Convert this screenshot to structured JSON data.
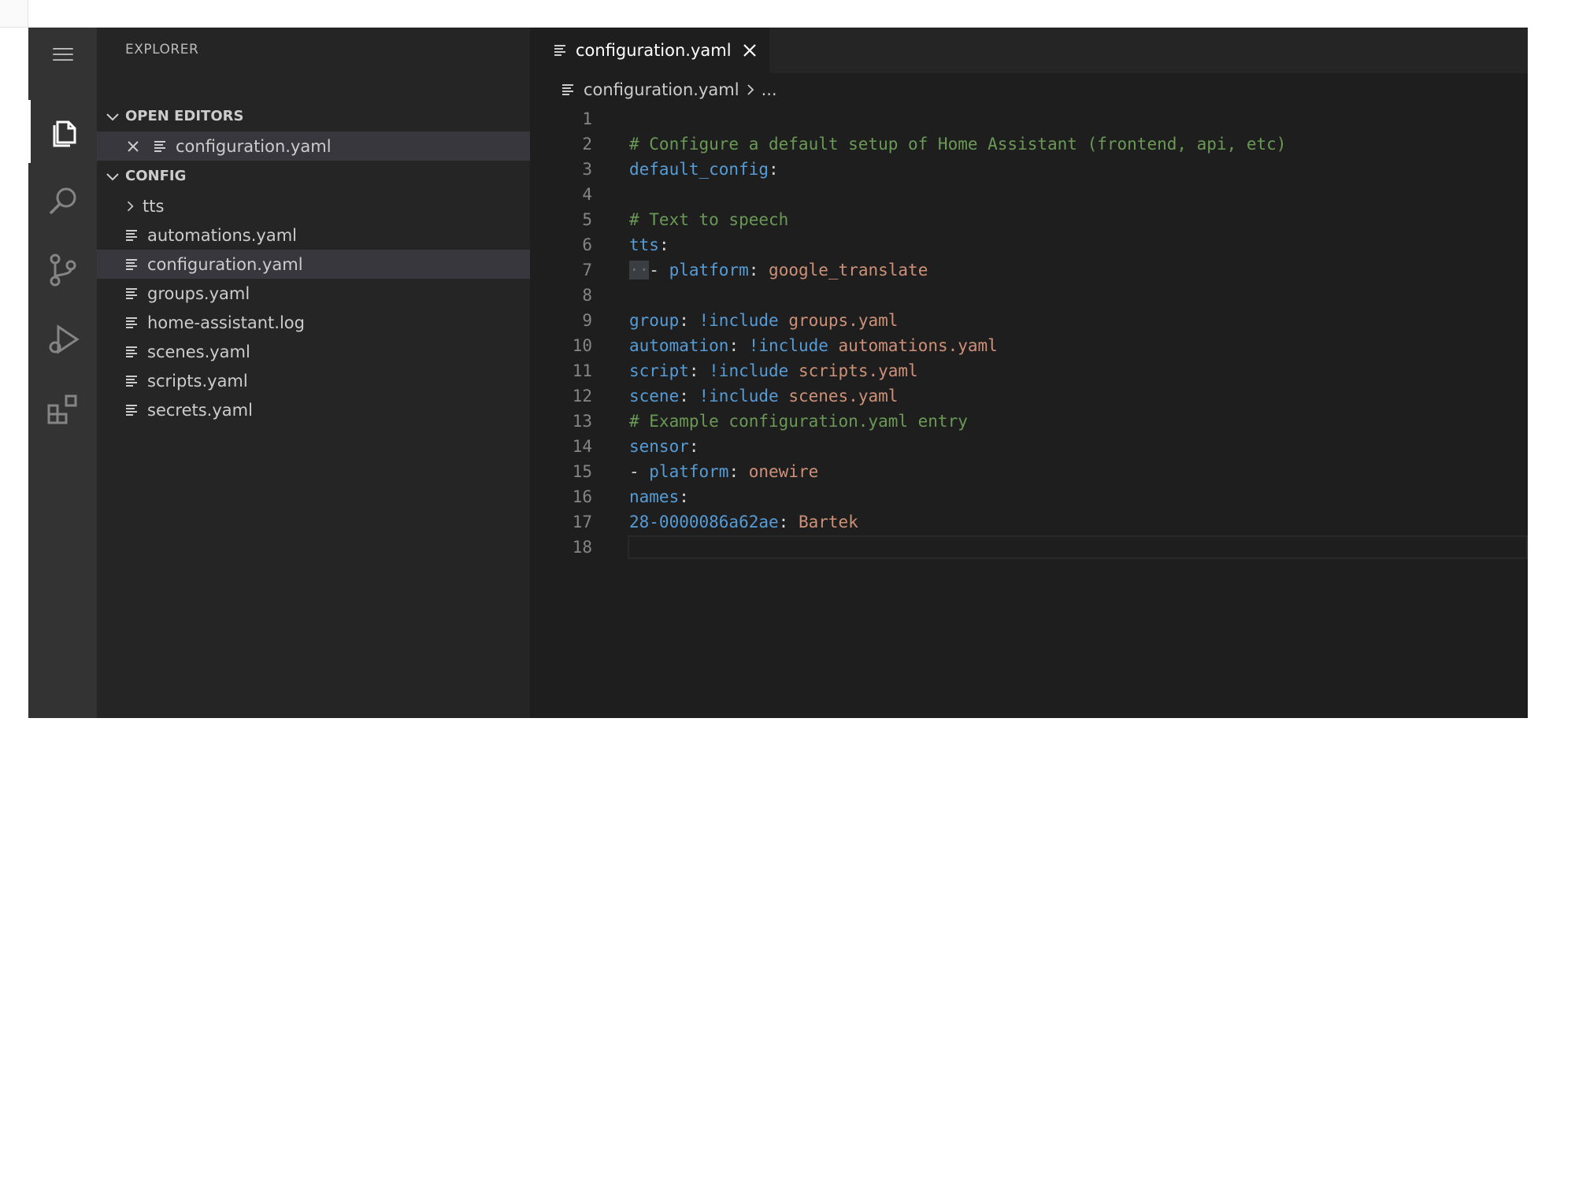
{
  "sidebar": {
    "title": "EXPLORER",
    "open_editors_label": "OPEN EDITORS",
    "open_editors": [
      "configuration.yaml"
    ],
    "folder_label": "CONFIG",
    "items": [
      {
        "label": "tts",
        "type": "folder"
      },
      {
        "label": "automations.yaml",
        "type": "file"
      },
      {
        "label": "configuration.yaml",
        "type": "file",
        "selected": true
      },
      {
        "label": "groups.yaml",
        "type": "file"
      },
      {
        "label": "home-assistant.log",
        "type": "file"
      },
      {
        "label": "scenes.yaml",
        "type": "file"
      },
      {
        "label": "scripts.yaml",
        "type": "file"
      },
      {
        "label": "secrets.yaml",
        "type": "file"
      }
    ]
  },
  "activity_bar": {
    "icons": [
      "menu-icon",
      "explorer-icon",
      "search-icon",
      "source-control-icon",
      "run-debug-icon",
      "extensions-icon"
    ]
  },
  "editor": {
    "tab_label": "configuration.yaml",
    "breadcrumb_file": "configuration.yaml",
    "breadcrumb_rest": "...",
    "lines": [
      {
        "n": "1",
        "parts": []
      },
      {
        "n": "2",
        "parts": [
          {
            "t": "# Configure a default setup of Home Assistant (frontend, api, etc)",
            "c": "comment"
          }
        ]
      },
      {
        "n": "3",
        "parts": [
          {
            "t": "default_config",
            "c": "key"
          },
          {
            "t": ":",
            "c": "punc"
          }
        ]
      },
      {
        "n": "4",
        "parts": []
      },
      {
        "n": "5",
        "parts": [
          {
            "t": "# Text to speech",
            "c": "comment"
          }
        ]
      },
      {
        "n": "6",
        "parts": [
          {
            "t": "tts",
            "c": "key"
          },
          {
            "t": ":",
            "c": "punc"
          }
        ]
      },
      {
        "n": "7",
        "parts": [
          {
            "t": "··",
            "c": "indent"
          },
          {
            "t": "- ",
            "c": "punc"
          },
          {
            "t": "platform",
            "c": "key"
          },
          {
            "t": ": ",
            "c": "punc"
          },
          {
            "t": "google_translate",
            "c": "val"
          }
        ]
      },
      {
        "n": "8",
        "parts": []
      },
      {
        "n": "9",
        "parts": [
          {
            "t": "group",
            "c": "key"
          },
          {
            "t": ": ",
            "c": "punc"
          },
          {
            "t": "!include",
            "c": "key"
          },
          {
            "t": " groups.yaml",
            "c": "val"
          }
        ]
      },
      {
        "n": "10",
        "parts": [
          {
            "t": "automation",
            "c": "key"
          },
          {
            "t": ": ",
            "c": "punc"
          },
          {
            "t": "!include",
            "c": "key"
          },
          {
            "t": " automations.yaml",
            "c": "val"
          }
        ]
      },
      {
        "n": "11",
        "parts": [
          {
            "t": "script",
            "c": "key"
          },
          {
            "t": ": ",
            "c": "punc"
          },
          {
            "t": "!include",
            "c": "key"
          },
          {
            "t": " scripts.yaml",
            "c": "val"
          }
        ]
      },
      {
        "n": "12",
        "parts": [
          {
            "t": "scene",
            "c": "key"
          },
          {
            "t": ": ",
            "c": "punc"
          },
          {
            "t": "!include",
            "c": "key"
          },
          {
            "t": " scenes.yaml",
            "c": "val"
          }
        ]
      },
      {
        "n": "13",
        "parts": [
          {
            "t": "# Example configuration.yaml entry",
            "c": "comment"
          }
        ]
      },
      {
        "n": "14",
        "parts": [
          {
            "t": "sensor",
            "c": "key"
          },
          {
            "t": ":",
            "c": "punc"
          }
        ]
      },
      {
        "n": "15",
        "parts": [
          {
            "t": "- ",
            "c": "punc"
          },
          {
            "t": "platform",
            "c": "key"
          },
          {
            "t": ": ",
            "c": "punc"
          },
          {
            "t": "onewire",
            "c": "val"
          }
        ]
      },
      {
        "n": "16",
        "parts": [
          {
            "t": "names",
            "c": "key"
          },
          {
            "t": ":",
            "c": "punc"
          }
        ]
      },
      {
        "n": "17",
        "parts": [
          {
            "t": "28-0000086a62ae",
            "c": "key"
          },
          {
            "t": ": ",
            "c": "punc"
          },
          {
            "t": "Bartek",
            "c": "val"
          }
        ]
      },
      {
        "n": "18",
        "parts": []
      }
    ]
  },
  "colors": {
    "comment": "#6a9955",
    "key": "#569cd6",
    "value": "#ce9178",
    "line_number": "#858585",
    "editor_bg": "#1e1e1e",
    "sidebar_bg": "#252526",
    "activity_bg": "#333333"
  }
}
